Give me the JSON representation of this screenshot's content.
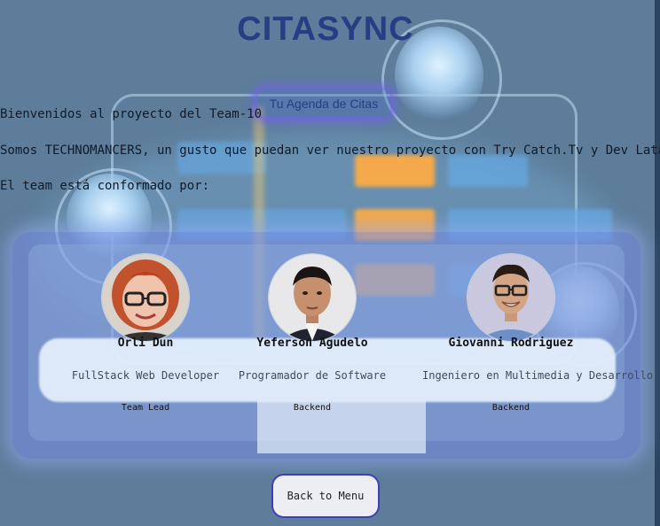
{
  "header": {
    "title": "CITASYNC",
    "subtitle": "Tu Agenda de Citas"
  },
  "intro": {
    "welcome": "Bienvenidos al proyecto del Team-10",
    "team_line": "Somos TECHNOMANCERS, un gusto que puedan ver nuestro proyecto con Try Catch.Tv y Dev Latam",
    "team_intro": "El team está conformado por:"
  },
  "members": [
    {
      "name": "Orli Dun",
      "role": "FullStack Web Developer",
      "tag": "Team Lead",
      "avatar": "woman-red-hair-glasses"
    },
    {
      "name": "Yeferson Agudelo",
      "role": "Programador de Software",
      "tag": "Backend",
      "avatar": "man-suit"
    },
    {
      "name": "Giovanni Rodriguez",
      "role": "Ingeniero en Multimedia y Desarrollo",
      "tag": "Backend",
      "avatar": "man-glasses-smiling"
    }
  ],
  "actions": {
    "back_label": "Back to Menu"
  },
  "colors": {
    "title": "#263f84",
    "button_border": "#3e3fb8",
    "panel_glow": "#8c9be8",
    "background": "#5d7d9a"
  }
}
